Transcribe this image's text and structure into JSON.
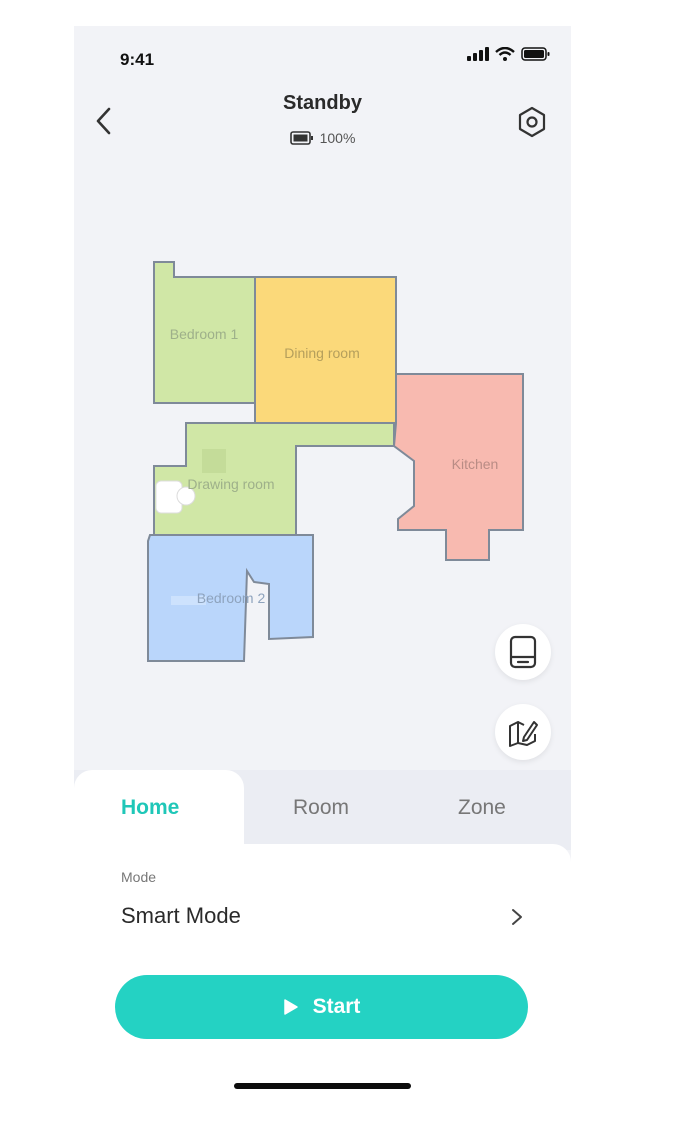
{
  "status_bar": {
    "time": "9:41"
  },
  "header": {
    "title": "Standby",
    "battery_level": "100%"
  },
  "map": {
    "rooms": [
      {
        "name": "Bedroom 1",
        "color": "#d0e7a6"
      },
      {
        "name": "Dining room",
        "color": "#fbd97a"
      },
      {
        "name": "Kitchen",
        "color": "#f8bab0"
      },
      {
        "name": "Drawing room",
        "color": "#d0e7a6"
      },
      {
        "name": "Bedroom 2",
        "color": "#bad6fb"
      }
    ],
    "outline_color": "#7f8a99"
  },
  "tabs": {
    "home": "Home",
    "room": "Room",
    "zone": "Zone",
    "active": "Home"
  },
  "mode": {
    "label": "Mode",
    "value": "Smart Mode"
  },
  "start_button": {
    "label": "Start"
  },
  "colors": {
    "accent": "#24d2c3",
    "active_tab": "#1fc7b8"
  }
}
